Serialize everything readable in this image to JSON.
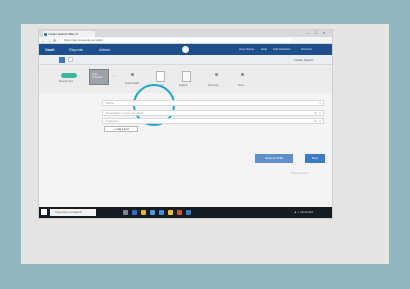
{
  "browser": {
    "tab_title": "Instant Search Wiki | X",
    "url": "https://app.example.com/wiki",
    "window_controls": [
      "–",
      "□",
      "×"
    ],
    "nav": [
      "←",
      "→",
      "⟳"
    ]
  },
  "app": {
    "brand": "Vault",
    "nav": [
      "Reports",
      "Admin"
    ],
    "header_links": [
      "User Name",
      "Help",
      "Administrator",
      "Account"
    ]
  },
  "subheader": {
    "right_text": "Instant Search"
  },
  "steps": {
    "first_caption": "Record Type",
    "thumb_text": "Copy Template",
    "captions": [
      "Select Fields",
      "Document",
      "Options",
      "Summary",
      "Done"
    ]
  },
  "form": {
    "field1_placeholder": "Name",
    "field2_placeholder": "Description of your template",
    "field3_placeholder": "Category",
    "add_button": "+ Add Field"
  },
  "buttons": {
    "secondary": "Save as Draft",
    "primary": "Next"
  },
  "note": "Required fields",
  "taskbar": {
    "search_placeholder": "Type here to search",
    "tray": "▲ ♪ 10:42 AM"
  },
  "colors": {
    "accent": "#3a7ac6",
    "header": "#1e4f8a",
    "highlight_ring": "#1fa7c9",
    "step_active": "#3ab79a"
  }
}
